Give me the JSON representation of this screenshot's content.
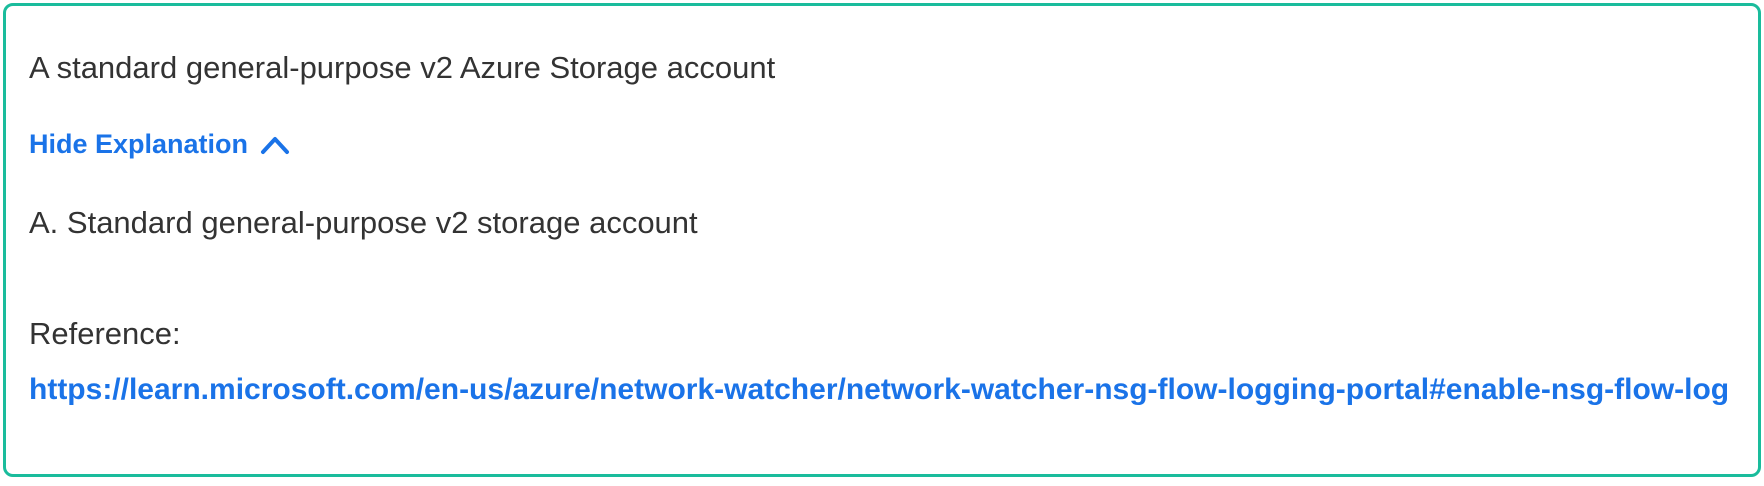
{
  "answer": {
    "text": "A standard general-purpose v2 Azure Storage account"
  },
  "explanation_toggle": {
    "label": "Hide Explanation",
    "icon": "chevron-up-icon"
  },
  "explanation": {
    "text": "A. Standard general-purpose v2 storage account",
    "reference_label": "Reference:",
    "reference_url": "https://learn.microsoft.com/en-us/azure/network-watcher/network-watcher-nsg-flow-logging-portal#enable-nsg-flow-log"
  },
  "colors": {
    "border": "#1abc9c",
    "link": "#1a73e8",
    "text": "#333333"
  }
}
